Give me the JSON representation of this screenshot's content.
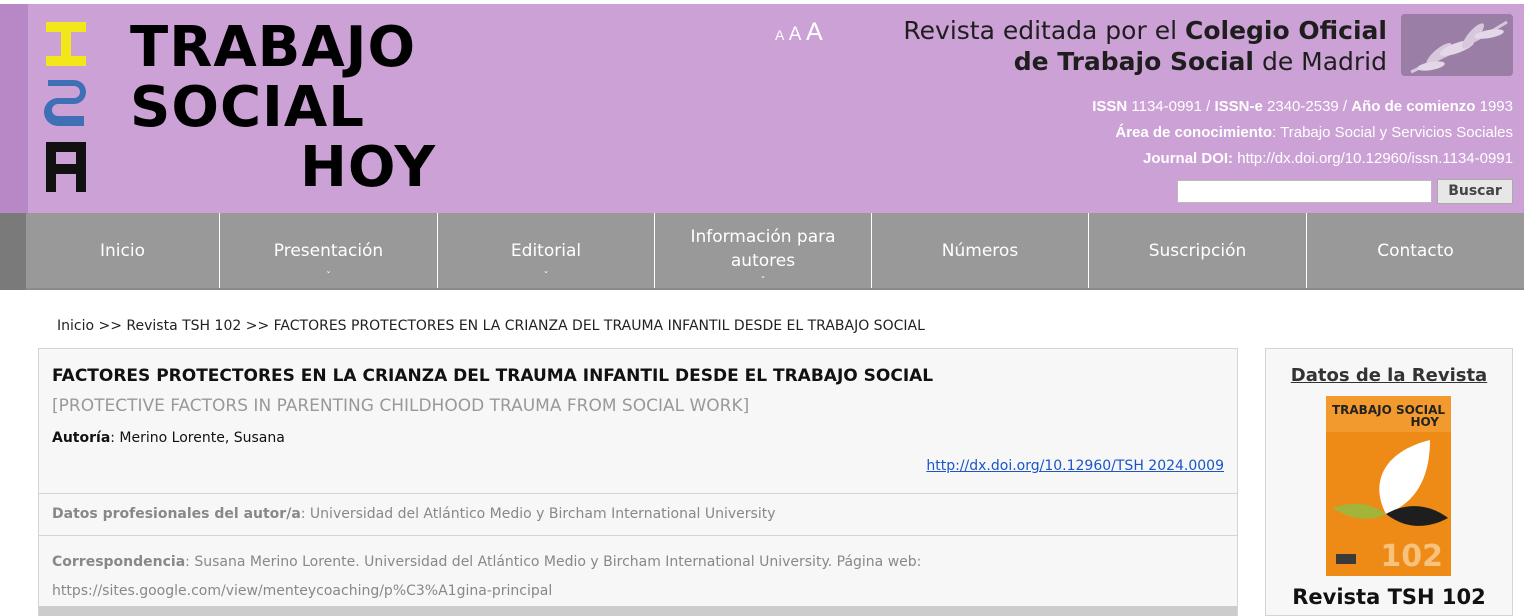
{
  "header": {
    "logo": {
      "side_text": "TSH",
      "line1": "TRABAJO",
      "line2": "SOCIAL",
      "line3": "HOY"
    },
    "font_sizer": {
      "small": "A",
      "medium": "A",
      "large": "A"
    },
    "publisher": {
      "prefix": "Revista editada por el ",
      "org_bold": "Colegio Oficial de Trabajo Social",
      "suffix": " de Madrid"
    },
    "issn_label": "ISSN",
    "issn_value": " 1134-0991 / ",
    "issne_label": "ISSN-e",
    "issne_value": " 2340-2539 / ",
    "year_label": "Año de comienzo",
    "year_value": " 1993",
    "area_label": "Área de conocimiento",
    "area_value": ": Trabajo Social y Servicios Sociales",
    "doi_label": "Journal DOI:",
    "doi_value": " http://dx.doi.org/10.12960/issn.1134-0991",
    "search": {
      "value": "",
      "button_label": "Buscar"
    }
  },
  "nav": {
    "items": [
      {
        "label": "Inicio"
      },
      {
        "label": "Presentación",
        "has_submenu": true
      },
      {
        "label": "Editorial",
        "has_submenu": true
      },
      {
        "label": "Información para autores",
        "has_submenu": true
      },
      {
        "label": "Números"
      },
      {
        "label": "Suscripción"
      },
      {
        "label": "Contacto"
      }
    ],
    "caret": "ˇ"
  },
  "breadcrumb": {
    "home": "Inicio",
    "sep1": " >> ",
    "issue": "Revista TSH 102",
    "sep2": " >> ",
    "current": "FACTORES PROTECTORES EN LA CRIANZA DEL TRAUMA INFANTIL DESDE EL TRABAJO SOCIAL"
  },
  "article": {
    "title": "FACTORES PROTECTORES EN LA CRIANZA DEL TRAUMA INFANTIL DESDE EL TRABAJO SOCIAL",
    "subtitle": "[PROTECTIVE FACTORS IN PARENTING CHILDHOOD TRAUMA FROM SOCIAL WORK]",
    "author_label": "Autoría",
    "author_value": ": Merino Lorente, Susana",
    "doi_link": "http://dx.doi.org/10.12960/TSH 2024.0009",
    "prof_label": "Datos profesionales del autor/a",
    "prof_value": ": Universidad del Atlántico Medio y Bircham International University",
    "corr_label": "Correspondencia",
    "corr_value": ": Susana Merino Lorente. Universidad del Atlántico Medio y Bircham International University. Página web: https://sites.google.com/view/menteycoaching/p%C3%A1gina-principal"
  },
  "sidebar": {
    "title": "Datos de la Revista",
    "cover": {
      "title_line1": "TRABAJO SOCIAL",
      "title_line2": "HOY",
      "number": "102"
    },
    "caption": "Revista TSH 102"
  },
  "colors": {
    "header_bg": "#cca1d6",
    "nav_bg": "#999999",
    "logo_yellow": "#f3e61b",
    "logo_blue": "#3f6fb5",
    "link_blue": "#1a55c9",
    "cover_orange": "#ee8a16"
  }
}
